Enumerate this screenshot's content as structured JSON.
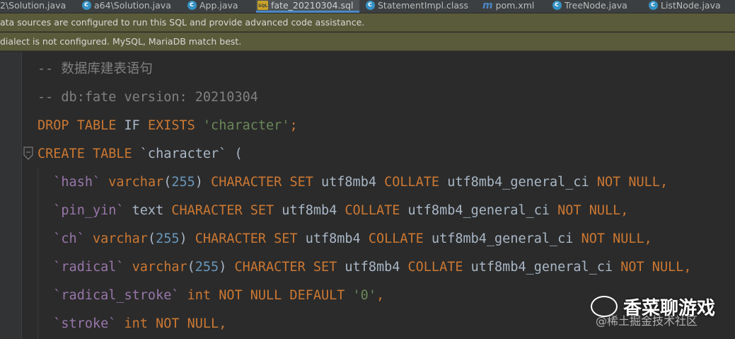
{
  "tabs": [
    {
      "label": "2\\Solution.java",
      "icon": "java-class-icon",
      "active": false
    },
    {
      "label": "a64\\Solution.java",
      "icon": "java-class-icon",
      "active": false
    },
    {
      "label": "App.java",
      "icon": "java-class-icon",
      "active": false
    },
    {
      "label": "fate_20210304.sql",
      "icon": "sql-file-icon",
      "active": true
    },
    {
      "label": "StatementImpl.class",
      "icon": "java-class-icon",
      "active": false
    },
    {
      "label": "pom.xml",
      "icon": "maven-icon",
      "active": false
    },
    {
      "label": "TreeNode.java",
      "icon": "java-class-icon",
      "active": false
    },
    {
      "label": "ListNode.java",
      "icon": "java-class-icon",
      "active": false
    }
  ],
  "banners": {
    "datasource": "ata sources are configured to run this SQL and provide advanced code assistance.",
    "dialect": "dialect is not configured. MySQL, MariaDB match best."
  },
  "code": {
    "comment1": "-- 数据库建表语句",
    "comment2": "-- db:fate version: 20210304",
    "drop_kw": "DROP TABLE ",
    "drop_if": "IF ",
    "drop_exists": "EXISTS ",
    "drop_str": "'character'",
    "drop_end": ";",
    "create_kw": "CREATE TABLE ",
    "create_name": "`character` (",
    "rows": [
      [
        "  `hash` ",
        "varchar",
        "(",
        "255",
        ") ",
        "CHARACTER SET ",
        "utf8mb4 ",
        "COLLATE ",
        "utf8mb4_general_ci ",
        "NOT NULL",
        ","
      ],
      [
        "  `pin_yin` ",
        "text ",
        "",
        "",
        "",
        "CHARACTER SET ",
        "utf8mb4 ",
        "COLLATE ",
        "utf8mb4_general_ci ",
        "NOT NULL",
        ","
      ],
      [
        "  `ch` ",
        "varchar",
        "(",
        "255",
        ") ",
        "CHARACTER SET ",
        "utf8mb4 ",
        "COLLATE ",
        "utf8mb4_general_ci ",
        "NOT NULL",
        ","
      ],
      [
        "  `radical` ",
        "varchar",
        "(",
        "255",
        ") ",
        "CHARACTER SET ",
        "utf8mb4 ",
        "COLLATE ",
        "utf8mb4_general_ci ",
        "NOT NULL",
        ","
      ]
    ],
    "stroke_line": {
      "name": "  `radical_stroke` ",
      "type": "int ",
      "kw": "NOT NULL DEFAULT ",
      "str": "'0'",
      "end": ","
    },
    "stroke2_line": {
      "name": "  `stroke` ",
      "type": "int ",
      "kw": "NOT NULL",
      "end": ","
    }
  },
  "watermark": {
    "main": "香菜聊游戏",
    "sub": "@稀土掘金技术社区"
  }
}
